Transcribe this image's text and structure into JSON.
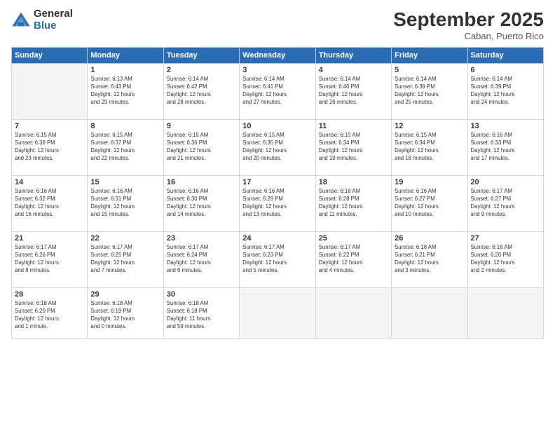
{
  "logo": {
    "general": "General",
    "blue": "Blue"
  },
  "title": "September 2025",
  "subtitle": "Caban, Puerto Rico",
  "days_of_week": [
    "Sunday",
    "Monday",
    "Tuesday",
    "Wednesday",
    "Thursday",
    "Friday",
    "Saturday"
  ],
  "weeks": [
    [
      {
        "num": "",
        "info": ""
      },
      {
        "num": "1",
        "info": "Sunrise: 6:13 AM\nSunset: 6:43 PM\nDaylight: 12 hours\nand 29 minutes."
      },
      {
        "num": "2",
        "info": "Sunrise: 6:14 AM\nSunset: 6:42 PM\nDaylight: 12 hours\nand 28 minutes."
      },
      {
        "num": "3",
        "info": "Sunrise: 6:14 AM\nSunset: 6:41 PM\nDaylight: 12 hours\nand 27 minutes."
      },
      {
        "num": "4",
        "info": "Sunrise: 6:14 AM\nSunset: 6:40 PM\nDaylight: 12 hours\nand 26 minutes."
      },
      {
        "num": "5",
        "info": "Sunrise: 6:14 AM\nSunset: 6:39 PM\nDaylight: 12 hours\nand 25 minutes."
      },
      {
        "num": "6",
        "info": "Sunrise: 6:14 AM\nSunset: 6:39 PM\nDaylight: 12 hours\nand 24 minutes."
      }
    ],
    [
      {
        "num": "7",
        "info": "Sunrise: 6:15 AM\nSunset: 6:38 PM\nDaylight: 12 hours\nand 23 minutes."
      },
      {
        "num": "8",
        "info": "Sunrise: 6:15 AM\nSunset: 6:37 PM\nDaylight: 12 hours\nand 22 minutes."
      },
      {
        "num": "9",
        "info": "Sunrise: 6:15 AM\nSunset: 6:36 PM\nDaylight: 12 hours\nand 21 minutes."
      },
      {
        "num": "10",
        "info": "Sunrise: 6:15 AM\nSunset: 6:35 PM\nDaylight: 12 hours\nand 20 minutes."
      },
      {
        "num": "11",
        "info": "Sunrise: 6:15 AM\nSunset: 6:34 PM\nDaylight: 12 hours\nand 19 minutes."
      },
      {
        "num": "12",
        "info": "Sunrise: 6:15 AM\nSunset: 6:34 PM\nDaylight: 12 hours\nand 18 minutes."
      },
      {
        "num": "13",
        "info": "Sunrise: 6:16 AM\nSunset: 6:33 PM\nDaylight: 12 hours\nand 17 minutes."
      }
    ],
    [
      {
        "num": "14",
        "info": "Sunrise: 6:16 AM\nSunset: 6:32 PM\nDaylight: 12 hours\nand 16 minutes."
      },
      {
        "num": "15",
        "info": "Sunrise: 6:16 AM\nSunset: 6:31 PM\nDaylight: 12 hours\nand 15 minutes."
      },
      {
        "num": "16",
        "info": "Sunrise: 6:16 AM\nSunset: 6:30 PM\nDaylight: 12 hours\nand 14 minutes."
      },
      {
        "num": "17",
        "info": "Sunrise: 6:16 AM\nSunset: 6:29 PM\nDaylight: 12 hours\nand 13 minutes."
      },
      {
        "num": "18",
        "info": "Sunrise: 6:16 AM\nSunset: 6:28 PM\nDaylight: 12 hours\nand 11 minutes."
      },
      {
        "num": "19",
        "info": "Sunrise: 6:16 AM\nSunset: 6:27 PM\nDaylight: 12 hours\nand 10 minutes."
      },
      {
        "num": "20",
        "info": "Sunrise: 6:17 AM\nSunset: 6:27 PM\nDaylight: 12 hours\nand 9 minutes."
      }
    ],
    [
      {
        "num": "21",
        "info": "Sunrise: 6:17 AM\nSunset: 6:26 PM\nDaylight: 12 hours\nand 8 minutes."
      },
      {
        "num": "22",
        "info": "Sunrise: 6:17 AM\nSunset: 6:25 PM\nDaylight: 12 hours\nand 7 minutes."
      },
      {
        "num": "23",
        "info": "Sunrise: 6:17 AM\nSunset: 6:24 PM\nDaylight: 12 hours\nand 6 minutes."
      },
      {
        "num": "24",
        "info": "Sunrise: 6:17 AM\nSunset: 6:23 PM\nDaylight: 12 hours\nand 5 minutes."
      },
      {
        "num": "25",
        "info": "Sunrise: 6:17 AM\nSunset: 6:22 PM\nDaylight: 12 hours\nand 4 minutes."
      },
      {
        "num": "26",
        "info": "Sunrise: 6:18 AM\nSunset: 6:21 PM\nDaylight: 12 hours\nand 3 minutes."
      },
      {
        "num": "27",
        "info": "Sunrise: 6:18 AM\nSunset: 6:20 PM\nDaylight: 12 hours\nand 2 minutes."
      }
    ],
    [
      {
        "num": "28",
        "info": "Sunrise: 6:18 AM\nSunset: 6:20 PM\nDaylight: 12 hours\nand 1 minute."
      },
      {
        "num": "29",
        "info": "Sunrise: 6:18 AM\nSunset: 6:19 PM\nDaylight: 12 hours\nand 0 minutes."
      },
      {
        "num": "30",
        "info": "Sunrise: 6:18 AM\nSunset: 6:18 PM\nDaylight: 11 hours\nand 59 minutes."
      },
      {
        "num": "",
        "info": ""
      },
      {
        "num": "",
        "info": ""
      },
      {
        "num": "",
        "info": ""
      },
      {
        "num": "",
        "info": ""
      }
    ]
  ]
}
